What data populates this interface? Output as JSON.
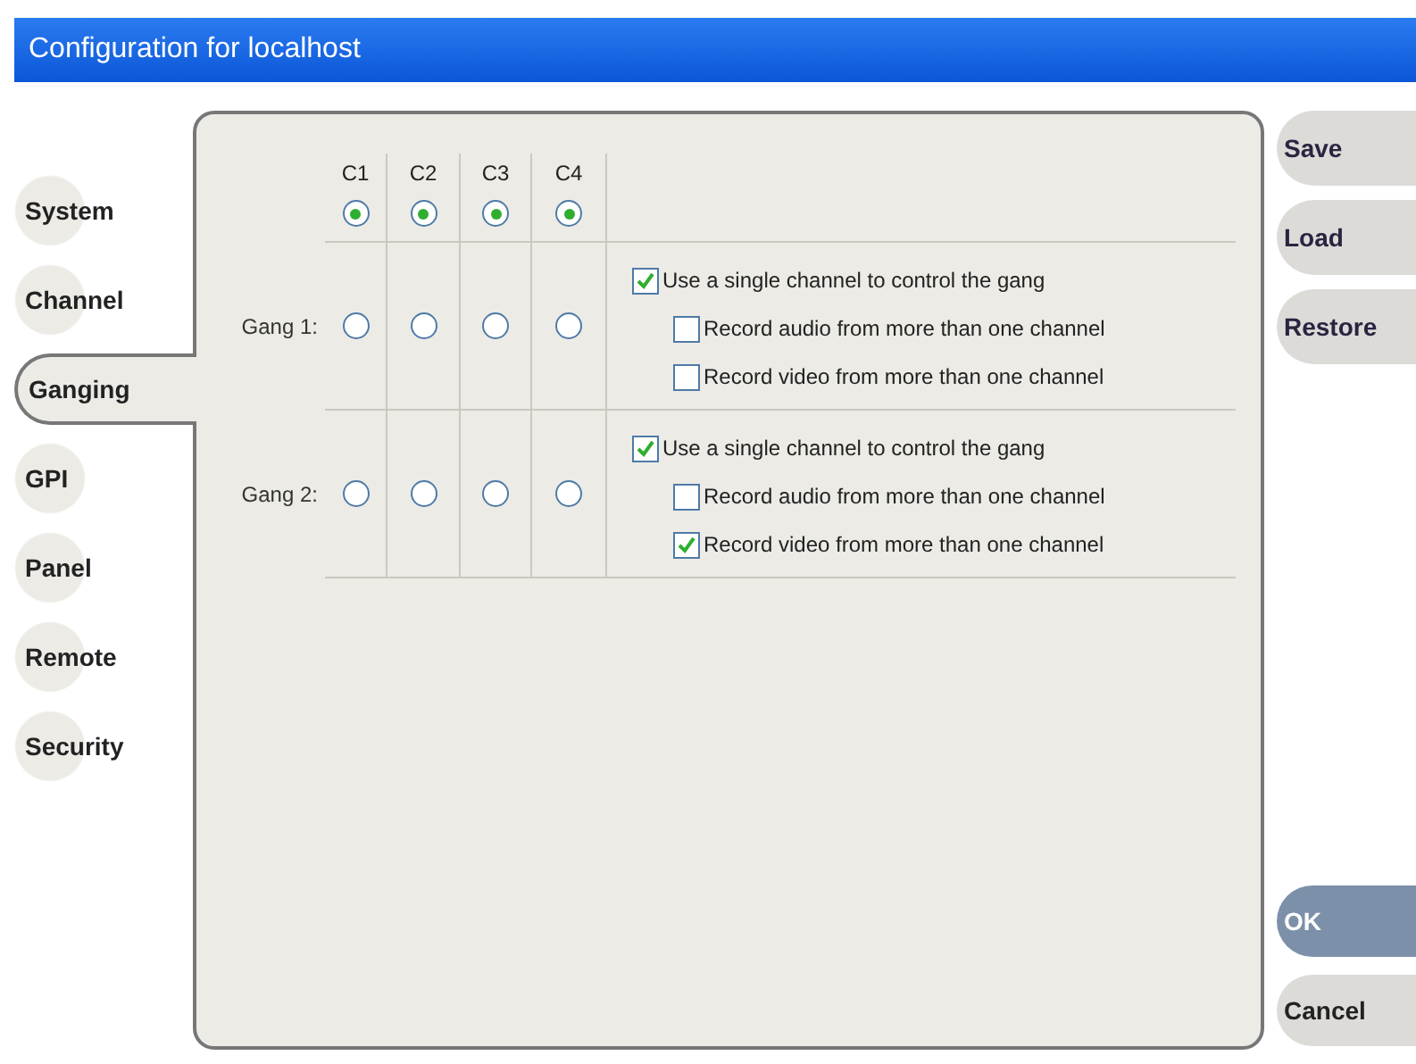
{
  "window": {
    "title": "Configuration for localhost"
  },
  "sidebar": {
    "items": [
      {
        "label": "System",
        "selected": false
      },
      {
        "label": "Channel",
        "selected": false
      },
      {
        "label": "Ganging",
        "selected": true
      },
      {
        "label": "GPI",
        "selected": false
      },
      {
        "label": "Panel",
        "selected": false
      },
      {
        "label": "Remote",
        "selected": false
      },
      {
        "label": "Security",
        "selected": false
      }
    ]
  },
  "channels": [
    {
      "label": "C1",
      "selected": true
    },
    {
      "label": "C2",
      "selected": true
    },
    {
      "label": "C3",
      "selected": true
    },
    {
      "label": "C4",
      "selected": true
    }
  ],
  "gangs": [
    {
      "label": "Gang 1:",
      "channels": [
        {
          "selected": false
        },
        {
          "selected": false
        },
        {
          "selected": false
        },
        {
          "selected": false
        }
      ],
      "options": [
        {
          "kind": "main",
          "label": "Use a single channel to control the gang",
          "checked": true
        },
        {
          "kind": "sub",
          "label": "Record audio from more than one channel",
          "checked": false
        },
        {
          "kind": "sub",
          "label": "Record video from more than one channel",
          "checked": false
        }
      ]
    },
    {
      "label": "Gang 2:",
      "channels": [
        {
          "selected": false
        },
        {
          "selected": false
        },
        {
          "selected": false
        },
        {
          "selected": false
        }
      ],
      "options": [
        {
          "kind": "main",
          "label": "Use a single channel to control the gang",
          "checked": true
        },
        {
          "kind": "sub",
          "label": "Record audio from more than one channel",
          "checked": false
        },
        {
          "kind": "sub",
          "label": "Record video from more than one channel",
          "checked": true
        }
      ]
    }
  ],
  "actions": [
    {
      "label": "Save"
    },
    {
      "label": "Load"
    },
    {
      "label": "Restore"
    }
  ],
  "dialog_buttons": [
    {
      "label": "OK",
      "selected": true
    },
    {
      "label": "Cancel",
      "selected": false
    }
  ]
}
